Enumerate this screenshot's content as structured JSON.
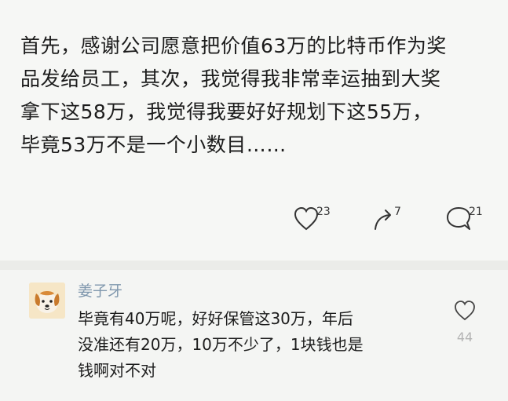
{
  "post": {
    "lines": [
      "首先，感谢公司愿意把价值63万的比特币作为奖",
      "品发给员工，其次，我觉得我非常幸运抽到大奖",
      "拿下这58万，我觉得我要好好规划下这55万，",
      "毕竟53万不是一个小数目……"
    ],
    "actions": {
      "like": {
        "icon": "heart-icon",
        "count": "23"
      },
      "share": {
        "icon": "share-arrow-icon",
        "count": "7"
      },
      "comment": {
        "icon": "speech-bubble-icon",
        "count": "21"
      }
    }
  },
  "comment": {
    "username": "姜子牙",
    "avatar_icon": "dog-avatar-icon",
    "lines": [
      "毕竟有40万呢，好好保管这30万，年后",
      "没准还有20万，10万不少了，1块钱也是",
      "钱啊对不对"
    ],
    "like": {
      "icon": "heart-icon",
      "count": "44"
    }
  },
  "colors": {
    "username": "#7f97ad",
    "text": "#1c1c1c",
    "background": "#f5f6f4"
  }
}
